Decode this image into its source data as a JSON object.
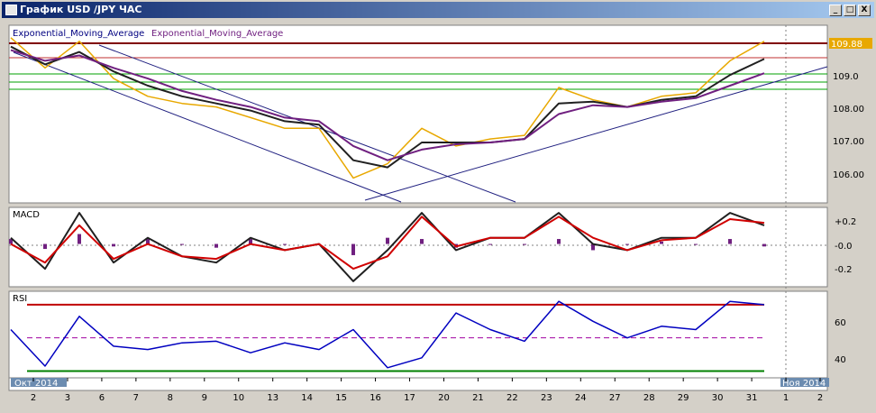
{
  "window": {
    "title": "График USD /JPY  ЧАС",
    "minimize_glyph": "_",
    "maximize_glyph": "□",
    "close_glyph": "X"
  },
  "chart_data": [
    {
      "type": "line",
      "panel": "price",
      "legend": [
        "Exponential_Moving_Average",
        "Exponential_Moving_Average"
      ],
      "current_price": "109.88",
      "y_ticks": [
        "109.0",
        "108.00",
        "107.00",
        "106.00"
      ],
      "ylim": [
        105.25,
        110.15
      ],
      "x": [
        0,
        1,
        2,
        3,
        4,
        5,
        6,
        7,
        8,
        9,
        10,
        11,
        12,
        13,
        14,
        15,
        16,
        17,
        18,
        19,
        20,
        21,
        22
      ],
      "series": [
        {
          "color": "#e8a800",
          "values": [
            109.85,
            109.0,
            109.75,
            108.7,
            108.2,
            108.0,
            107.9,
            107.6,
            107.3,
            107.3,
            105.9,
            106.3,
            107.3,
            106.8,
            107.0,
            107.1,
            108.45,
            108.1,
            107.9,
            108.2,
            108.3,
            109.2,
            109.75
          ]
        },
        {
          "color": "#202020",
          "values": [
            109.6,
            109.1,
            109.45,
            108.9,
            108.5,
            108.2,
            108.0,
            107.8,
            107.5,
            107.4,
            106.4,
            106.2,
            106.9,
            106.9,
            106.9,
            107.0,
            108.0,
            108.05,
            107.9,
            108.1,
            108.2,
            108.8,
            109.25
          ]
        },
        {
          "color": "#702080",
          "values": [
            109.5,
            109.2,
            109.35,
            109.0,
            108.7,
            108.35,
            108.1,
            107.9,
            107.6,
            107.5,
            106.8,
            106.4,
            106.7,
            106.85,
            106.9,
            107.0,
            107.7,
            107.95,
            107.9,
            108.05,
            108.15,
            108.5,
            108.85
          ]
        }
      ]
    },
    {
      "type": "line",
      "panel": "macd",
      "title": "MACD",
      "y_ticks": [
        "+0.2",
        "-0.0",
        "-0.2"
      ],
      "ylim": [
        -0.33,
        0.28
      ],
      "x": [
        0,
        1,
        2,
        3,
        4,
        5,
        6,
        7,
        8,
        9,
        10,
        11,
        12,
        13,
        14,
        15,
        16,
        17,
        18,
        19,
        20,
        21,
        22
      ],
      "series": [
        {
          "color": "#202020",
          "values": [
            0.05,
            -0.2,
            0.25,
            -0.15,
            0.05,
            -0.1,
            -0.15,
            0.05,
            -0.05,
            0.0,
            -0.3,
            -0.05,
            0.25,
            -0.05,
            0.05,
            0.05,
            0.25,
            0.0,
            -0.05,
            0.05,
            0.05,
            0.25,
            0.15
          ]
        },
        {
          "color": "#d00000",
          "values": [
            0.0,
            -0.15,
            0.15,
            -0.12,
            0.0,
            -0.1,
            -0.12,
            0.0,
            -0.05,
            0.0,
            -0.2,
            -0.1,
            0.22,
            -0.02,
            0.05,
            0.05,
            0.22,
            0.05,
            -0.05,
            0.03,
            0.05,
            0.2,
            0.17
          ]
        }
      ],
      "histogram_color": "#702080",
      "histogram": [
        0.04,
        -0.04,
        0.08,
        -0.02,
        0.04,
        0.0,
        -0.03,
        0.04,
        0.0,
        0.0,
        -0.09,
        0.05,
        0.04,
        -0.03,
        0.0,
        0.0,
        0.04,
        -0.05,
        0.0,
        0.02,
        0.0,
        0.04,
        -0.02
      ]
    },
    {
      "type": "line",
      "panel": "rsi",
      "title": "RSI",
      "y_ticks": [
        "60",
        "40"
      ],
      "ylim": [
        27,
        77
      ],
      "levels": [
        30,
        50,
        70
      ],
      "x": [
        0,
        1,
        2,
        3,
        4,
        5,
        6,
        7,
        8,
        9,
        10,
        11,
        12,
        13,
        14,
        15,
        16,
        17,
        18,
        19,
        20,
        21,
        22
      ],
      "series": [
        {
          "color": "#0000c0",
          "values": [
            55,
            33,
            63,
            45,
            43,
            47,
            48,
            41,
            47,
            43,
            55,
            32,
            38,
            65,
            55,
            48,
            72,
            60,
            50,
            57,
            55,
            72,
            70
          ]
        }
      ]
    }
  ],
  "time_axis": {
    "month_start": "Окт 2014",
    "month_next": "Ноя 2014",
    "labels": [
      "2",
      "3",
      "6",
      "7",
      "8",
      "9",
      "10",
      "13",
      "14",
      "15",
      "16",
      "17",
      "20",
      "21",
      "22",
      "23",
      "24",
      "27",
      "28",
      "29",
      "30",
      "31",
      "1",
      "2"
    ]
  },
  "colors": {
    "chart_bg": "#ffffff",
    "resistance": "#800000",
    "channel": "#202080",
    "support_green": "#00a000",
    "legend_purple": "#702080"
  }
}
